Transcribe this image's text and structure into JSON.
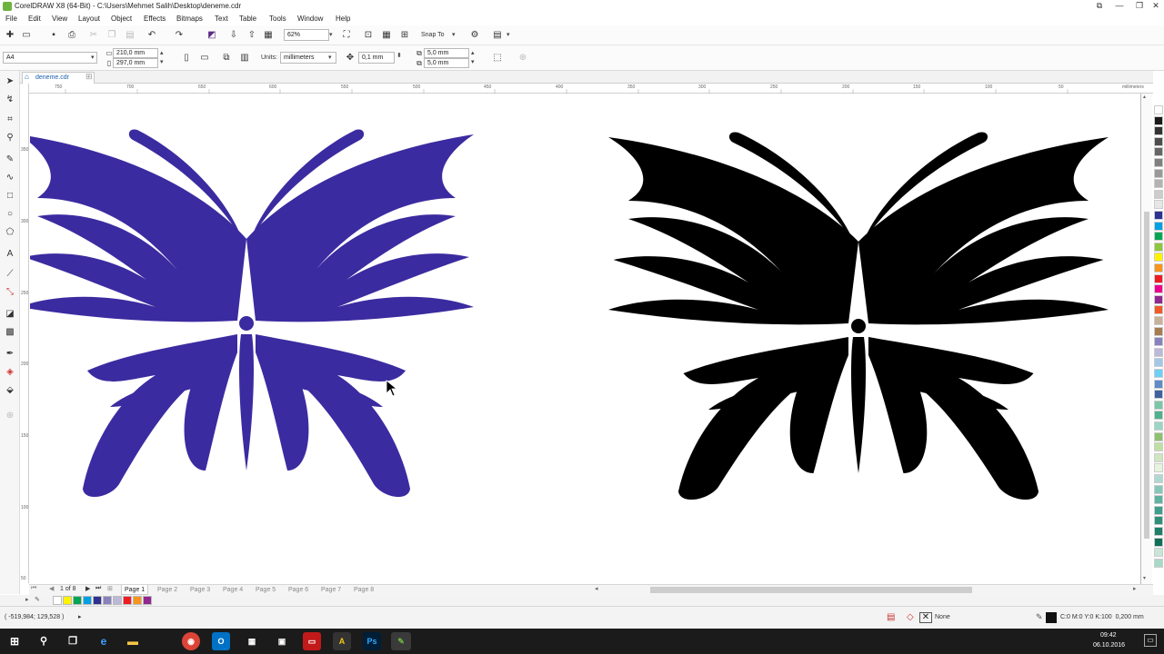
{
  "window": {
    "title": "CorelDRAW X8 (64-Bit) - C:\\Users\\Mehmet Salih\\Desktop\\deneme.cdr",
    "controls": [
      "⧉",
      "—",
      "❐",
      "✕"
    ]
  },
  "menu": [
    "File",
    "Edit",
    "View",
    "Layout",
    "Object",
    "Effects",
    "Bitmaps",
    "Text",
    "Table",
    "Tools",
    "Window",
    "Help"
  ],
  "toolbar": {
    "zoom_value": "62%",
    "snap_label": "Snap To"
  },
  "properties": {
    "page_size": "A4",
    "width": "210,0 mm",
    "height": "297,0 mm",
    "units_label": "Units:",
    "units_value": "millimeters",
    "nudge": "0,1 mm",
    "dup_x": "5,0 mm",
    "dup_y": "5,0 mm"
  },
  "document_tab": "deneme.cdr",
  "rulers": {
    "h_ticks": [
      "750",
      "700",
      "650",
      "600",
      "550",
      "500",
      "450",
      "400",
      "350",
      "300",
      "250",
      "200",
      "150",
      "100",
      "50",
      "millimeters"
    ],
    "v_ticks": [
      "350",
      "300",
      "250",
      "200",
      "150",
      "100",
      "50"
    ]
  },
  "canvas": {
    "left_butterfly_color": "#3b2ba0",
    "right_butterfly_color": "#000000"
  },
  "page_nav": {
    "counter": "1 of 8",
    "pages": [
      "Page 1",
      "Page 2",
      "Page 3",
      "Page 4",
      "Page 5",
      "Page 6",
      "Page 7",
      "Page 8"
    ]
  },
  "status": {
    "coords": "( -519,984; 129,528 )",
    "fill_label": "None",
    "outline_info": "C:0 M:0 Y:0 K:100  0,200 mm"
  },
  "taskbar": {
    "time": "09:42",
    "date": "06.10.2016"
  },
  "palette_colors": [
    "#ffffff",
    "#1a1a1a",
    "#333333",
    "#4d4d4d",
    "#666666",
    "#808080",
    "#999999",
    "#b3b3b3",
    "#cccccc",
    "#e6e6e6",
    "#2e3192",
    "#00a0e3",
    "#00a651",
    "#8dc63f",
    "#fff200",
    "#f7941d",
    "#ed1c24",
    "#ec008c",
    "#92278f",
    "#f15a24",
    "#c7b299",
    "#a67c52",
    "#8781bd",
    "#bcb8d8",
    "#a3c7e8",
    "#6dcff6",
    "#5f8bc7",
    "#3f5f9f",
    "#7ac7a8",
    "#4fb08c",
    "#9bd5c5",
    "#8fc06f",
    "#bfe0a4",
    "#cfe6c0",
    "#e8f3df",
    "#b0d8d0",
    "#86c8b8",
    "#5fb3a0",
    "#3f9f8a",
    "#2f8f78",
    "#1f7f68",
    "#0f6f58",
    "#c8e6d8",
    "#a8d8c8"
  ],
  "doc_palette": [
    "#ffffff",
    "#fff200",
    "#00a651",
    "#00a0e3",
    "#2e3192",
    "#8781bd",
    "#bcb8d8",
    "#ed1c24",
    "#f7941d",
    "#92278f"
  ]
}
